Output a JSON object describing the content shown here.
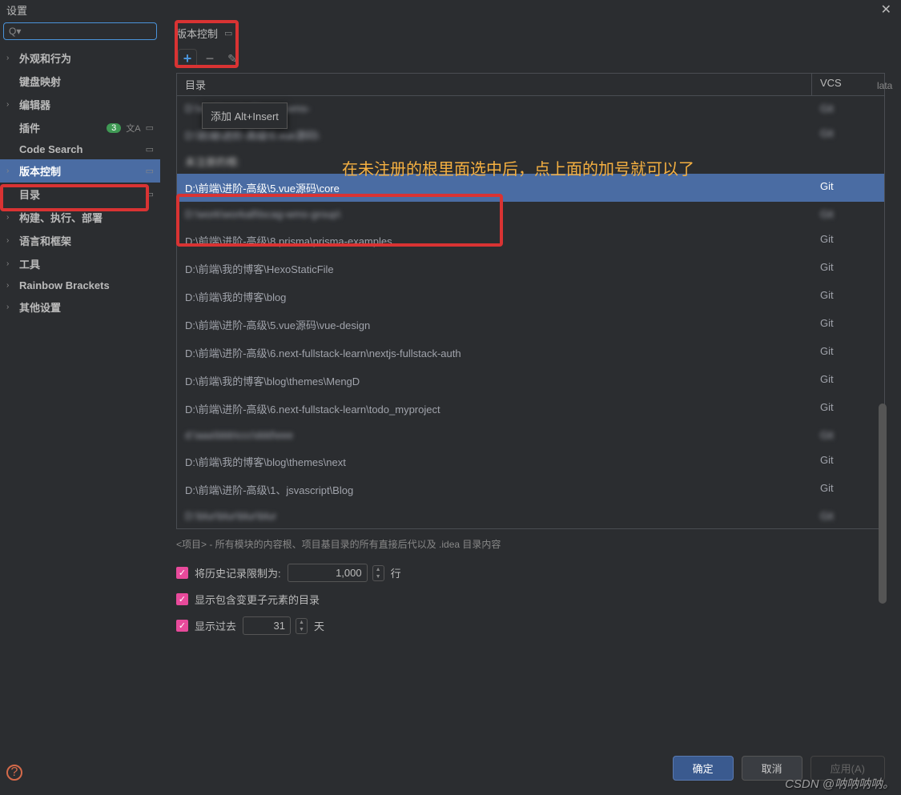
{
  "title": "设置",
  "search": {
    "placeholder": ""
  },
  "sidebar": {
    "items": [
      {
        "label": "外观和行为",
        "expandable": true
      },
      {
        "label": "键盘映射",
        "expandable": false
      },
      {
        "label": "编辑器",
        "expandable": true
      },
      {
        "label": "插件",
        "expandable": false,
        "badge": "3"
      },
      {
        "label": "Code Search",
        "expandable": false
      },
      {
        "label": "版本控制",
        "expandable": true,
        "selected": true
      },
      {
        "label": "目录",
        "expandable": false
      },
      {
        "label": "构建、执行、部署",
        "expandable": true
      },
      {
        "label": "语言和框架",
        "expandable": true
      },
      {
        "label": "工具",
        "expandable": true
      },
      {
        "label": "Rainbow Brackets",
        "expandable": true
      },
      {
        "label": "其他设置",
        "expandable": true
      }
    ]
  },
  "content": {
    "breadcrumb": "版本控制",
    "tooltip": "添加  Alt+Insert",
    "annotation": "在未注册的根里面选中后，点上面的加号就可以了",
    "table": {
      "headers": {
        "dir": "目录",
        "vcs": "VCS"
      },
      "section_label": "未注册的根:",
      "rows_top": [
        {
          "dir": "D:\\work\\workall\\lscas-wms-",
          "vcs": "Git",
          "blurred": true
        },
        {
          "dir": "D:\\前端\\进阶-高级\\5.vue源码\\",
          "vcs": "Git",
          "blurred": true
        }
      ],
      "rows": [
        {
          "dir": "D:\\前端\\进阶-高级\\5.vue源码\\core",
          "vcs": "Git",
          "selected": true
        },
        {
          "dir": "D:\\work\\workall\\lscag-wms-group\\",
          "vcs": "Git",
          "blurred": true
        },
        {
          "dir": "D:\\前端\\进阶-高级\\8.prisma\\prisma-examples",
          "vcs": "Git"
        },
        {
          "dir": "D:\\前端\\我的博客\\HexoStaticFile",
          "vcs": "Git"
        },
        {
          "dir": "D:\\前端\\我的博客\\blog",
          "vcs": "Git"
        },
        {
          "dir": "D:\\前端\\进阶-高级\\5.vue源码\\vue-design",
          "vcs": "Git"
        },
        {
          "dir": "D:\\前端\\进阶-高级\\6.next-fullstack-learn\\nextjs-fullstack-auth",
          "vcs": "Git"
        },
        {
          "dir": "D:\\前端\\我的博客\\blog\\themes\\MengD",
          "vcs": "Git"
        },
        {
          "dir": "D:\\前端\\进阶-高级\\6.next-fullstack-learn\\todo_myproject",
          "vcs": "Git"
        },
        {
          "dir": "d:\\aaa\\bbb\\ccc\\ddd\\eee",
          "vcs": "Git",
          "blurred": true
        },
        {
          "dir": "D:\\前端\\我的博客\\blog\\themes\\next",
          "vcs": "Git"
        },
        {
          "dir": "D:\\前端\\进阶-高级\\1、jsvascript\\Blog",
          "vcs": "Git"
        },
        {
          "dir": "D:\\blur\\blur\\blur\\blur",
          "vcs": "Git",
          "blurred": true
        }
      ]
    },
    "help_text": "<项目> - 所有模块的内容根、项目基目录的所有直接后代以及 .idea 目录内容",
    "options": {
      "history_limit_label": "将历史记录限制为:",
      "history_limit_value": "1,000",
      "history_limit_unit": "行",
      "show_changed_dirs": "显示包含变更子元素的目录",
      "show_past_label": "显示过去",
      "show_past_value": "31",
      "show_past_unit": "天"
    }
  },
  "footer": {
    "ok": "确定",
    "cancel": "取消",
    "apply": "应用(A)"
  },
  "watermark": "CSDN @呐呐呐呐。",
  "right_text": "lata"
}
